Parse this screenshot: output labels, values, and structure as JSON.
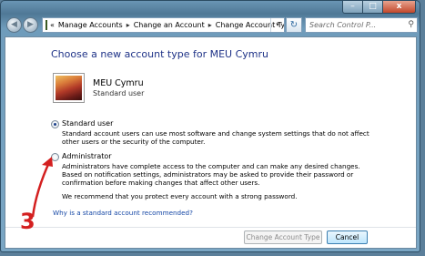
{
  "window": {
    "controls": {
      "minimize": "–",
      "maximize": "□",
      "close": "x"
    }
  },
  "nav": {
    "back_glyph": "◀",
    "forward_glyph": "▶",
    "address": {
      "overflow": "«",
      "crumbs": [
        "Manage Accounts",
        "Change an Account",
        "Change Account Type"
      ],
      "separator": "▸",
      "dropdown_glyph": "▾"
    },
    "refresh_glyph": "↻",
    "search_placeholder": "Search Control P...",
    "search_glyph": "⚲"
  },
  "content": {
    "heading": "Choose a new account type for MEU Cymru",
    "user": {
      "name": "MEU Cymru",
      "type": "Standard user"
    },
    "options": [
      {
        "label": "Standard user",
        "checked": true,
        "description": "Standard account users can use most software and change system settings that do not affect other users or the security of the computer."
      },
      {
        "label": "Administrator",
        "checked": false,
        "description": "Administrators have complete access to the computer and can make any desired changes. Based on notification settings, administrators may be asked to provide their password or confirmation before making changes that affect other users."
      }
    ],
    "recommendation": "We recommend that you protect every account with a strong password.",
    "help_link": "Why is a standard account recommended?"
  },
  "buttons": {
    "change": "Change Account Type",
    "cancel": "Cancel"
  },
  "annotation": {
    "number": "3",
    "color": "#d42020"
  }
}
